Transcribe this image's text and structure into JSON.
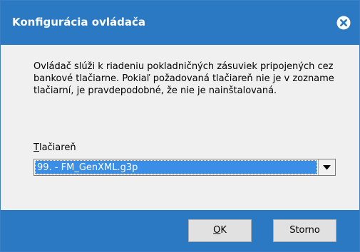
{
  "dialog": {
    "title": "Konfigurácia ovládača",
    "close_icon": "close-circle-icon",
    "description": "Ovládač slúži k riadeniu pokladničných zásuviek pripojených cez bankové tlačiarne. Pokiaľ požadovaná tlačiareň nie je v zozname tlačiarní, je pravdepodobné, že nie je nainštalovaná.",
    "printer_label_accel": "T",
    "printer_label_rest": "lačiareň",
    "printer_selected": "99. - FM_GenXML.g3p",
    "dropdown_icon": "chevron-down-icon",
    "ok_accel": "O",
    "ok_rest": "K",
    "cancel_label": "Storno"
  },
  "colors": {
    "titlebar": "#2b79c2",
    "footer": "#2b79c2",
    "selection": "#3a8ee6"
  }
}
